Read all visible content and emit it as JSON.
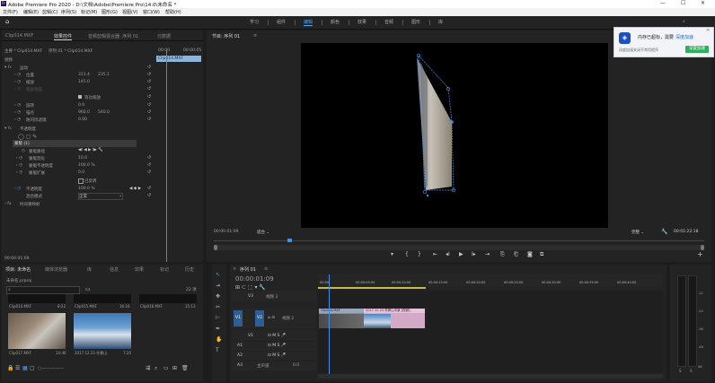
{
  "window": {
    "title": "Adobe Premiere Pro 2020 - D:\\文档\\Adobe\\Premiere Pro\\14.0\\未命名 *",
    "minimize": "—",
    "maximize": "☐",
    "close": "✕",
    "logo": "Pr"
  },
  "menu": [
    "文件(F)",
    "编辑(E)",
    "剪辑(C)",
    "序列(S)",
    "标记(M)",
    "图形(G)",
    "视图(V)",
    "窗口(W)",
    "帮助(H)"
  ],
  "workspaces": [
    "学习",
    "组件",
    "编辑",
    "颜色",
    "效果",
    "音频",
    "图形",
    "库"
  ],
  "active_workspace": "编辑",
  "effect_controls": {
    "tabs": [
      "Clip014.MXF",
      "效果控件",
      "音频剪辑混合器: 序列 01",
      "元数据"
    ],
    "active_tab": "效果控件",
    "source_label": "主要 * Clip014.MXF",
    "sequence_label": "序列 01 * Clip014.MXF",
    "video_header": "视频",
    "time_start": "00:00",
    "time_end": "00:00:05",
    "clip_bar_label": "Clip014.MXF",
    "motion": "运动",
    "position_label": "位置",
    "position_x": "311.4",
    "position_y": "235.1",
    "scale_label": "缩放",
    "scale_value": "145.0",
    "scale_width_label": "缩放宽度",
    "uniform_scale": "等比缩放",
    "rotation_label": "旋转",
    "rotation_value": "0.0",
    "anchor_label": "锚点",
    "anchor_x": "960.0",
    "anchor_y": "540.0",
    "flicker_label": "防闪烁滤镜",
    "flicker_value": "0.00",
    "opacity_section": "不透明度",
    "mask_label": "蒙版 (1)",
    "mask_path_label": "蒙版路径",
    "mask_feather_label": "蒙版羽化",
    "mask_feather_value": "10.0",
    "mask_opacity_label": "蒙版不透明度",
    "mask_opacity_value": "100.0 %",
    "mask_expansion_label": "蒙版扩展",
    "mask_expansion_value": "0.0",
    "inverted_label": "已反转",
    "opacity_label": "不透明度",
    "opacity_value": "100.0 %",
    "blend_label": "混合模式",
    "blend_value": "正常",
    "time_remap": "时间重映射",
    "current_time": "00:00:01:09"
  },
  "program": {
    "tab_label": "节目: 序列 01",
    "timecode": "00:00:01:09",
    "fit": "适合",
    "quality": "完整",
    "duration": "00:01:22:18",
    "playhead_fraction": 0.15
  },
  "notification": {
    "title": "内存已超标，需要",
    "link": "深度加速",
    "desc": "深度加速关闭不常用程序",
    "button": "深度加速"
  },
  "project": {
    "tabs": [
      "项目: 未命名",
      "媒体浏览器",
      "库",
      "信息",
      "效果",
      "标记",
      "历史"
    ],
    "active_tab": "项目: 未命名",
    "file_name": "未命名.prproj",
    "count": "22 项",
    "items": [
      {
        "name": "Clip014.MXF",
        "duration": "8:22"
      },
      {
        "name": "Clip015.MXF",
        "duration": "16:16"
      },
      {
        "name": "Clip016.MXF",
        "duration": "15:13"
      },
      {
        "name": "Clip017.MXF",
        "duration": "14:46"
      },
      {
        "name": "2017.12.23 冬雾山.",
        "duration": "7:20"
      }
    ]
  },
  "timeline": {
    "tab_label": "序列 01",
    "timecode": "00:00:01:09",
    "ruler": [
      "00:00",
      "00:00:05:00",
      "00:00:10:00",
      "00:00:15:00",
      "00:00:20:00",
      "00:00:25:00",
      "00:00:30:00",
      "00:00:35:00",
      "00:00:40:00"
    ],
    "v3": "V3",
    "v2": "V2",
    "v1": "V1",
    "a1": "A1",
    "a2": "A2",
    "a3": "A3",
    "track_v3": "视频 3",
    "track_v2": "视频 2",
    "master": "主声道",
    "master_value": "0.0",
    "clip1": "Clip014.MXF",
    "clip2": "2017.12.23 冬雾山中景 [视频]",
    "playhead_fraction": 0.03
  },
  "meter": {
    "labels": [
      "-12",
      "-24",
      "-36",
      "-48",
      "dB"
    ],
    "s1": "S",
    "s2": "S"
  }
}
